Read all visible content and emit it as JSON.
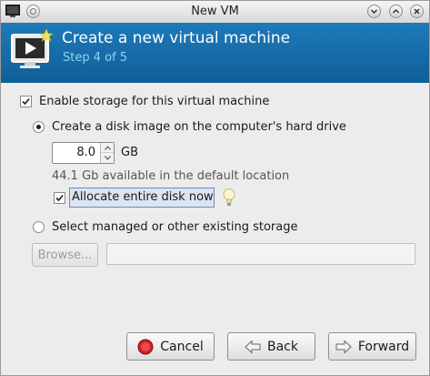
{
  "window": {
    "title": "New VM"
  },
  "banner": {
    "title": "Create a new virtual machine",
    "step": "Step 4 of 5",
    "accent_color": "#1f7ab8",
    "step_color": "#8fd2f5"
  },
  "storage": {
    "enable_label": "Enable storage for this virtual machine",
    "enable_checked": true,
    "create_disk_label": "Create a disk image on the computer's hard drive",
    "create_disk_selected": true,
    "size_value": "8.0",
    "size_unit": "GB",
    "available_hint": "44.1 Gb available in the default location",
    "allocate_label": "Allocate entire disk now",
    "allocate_checked": true,
    "allocate_tip_icon": "lightbulb-icon",
    "managed_label": "Select managed or other existing storage",
    "managed_selected": false,
    "browse_label": "Browse...",
    "storage_path_value": ""
  },
  "buttons": {
    "cancel_label": "Cancel",
    "back_label": "Back",
    "forward_label": "Forward"
  }
}
